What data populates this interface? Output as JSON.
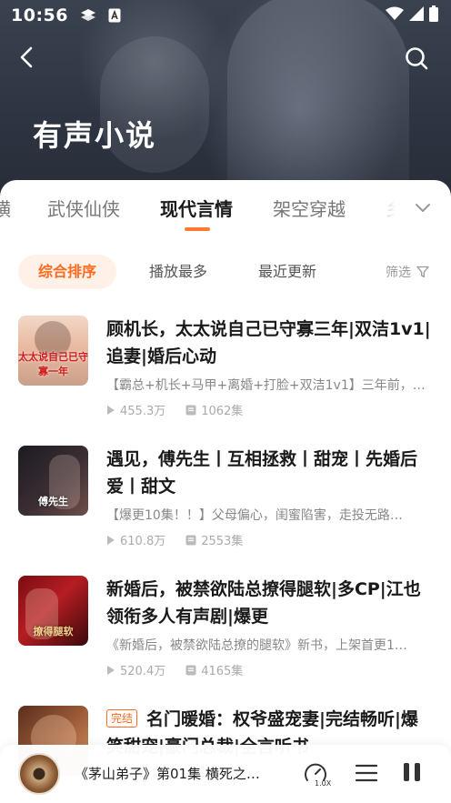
{
  "status_bar": {
    "time": "10:56"
  },
  "header": {
    "title": "有声小说"
  },
  "tabs": [
    {
      "label": "横",
      "active": false
    },
    {
      "label": "武侠仙侠",
      "active": false
    },
    {
      "label": "现代言情",
      "active": true
    },
    {
      "label": "架空穿越",
      "active": false
    },
    {
      "label": "乡",
      "active": false
    }
  ],
  "sort": {
    "options": [
      {
        "label": "综合排序",
        "active": true
      },
      {
        "label": "播放最多",
        "active": false
      },
      {
        "label": "最近更新",
        "active": false
      }
    ],
    "filter_label": "筛选"
  },
  "books": [
    {
      "cover_text": "太太说自己已守寡一年",
      "title": "顾机长，太太说自己已守寡三年|双洁1v1|追妻|婚后心动",
      "badge": "",
      "description": "【霸总+机长+马甲+离婚+打脸+双洁1v1】三年前，…",
      "plays": "455.3万",
      "episodes": "1062集"
    },
    {
      "cover_text": "傅先生",
      "title": "遇见，傅先生丨互相拯救丨甜宠丨先婚后爱丨甜文",
      "badge": "",
      "description": "【爆更10集！！】父母偏心，闺蜜陷害，走投无路…",
      "plays": "610.8万",
      "episodes": "2553集"
    },
    {
      "cover_text": "撩得腿软",
      "title": "新婚后，被禁欲陆总撩得腿软|多CP|江也领衔多人有声剧|爆更",
      "badge": "",
      "description": "《新婚后，被禁欲陆总撩的腿软》新书，上架首更1…",
      "plays": "520.4万",
      "episodes": "4165集"
    },
    {
      "cover_text": "",
      "title": "名门暖婚：权爷盛宠妻|完结畅听|爆笑甜宠|豪门总裁|全言听书",
      "badge": "完结",
      "description": "",
      "plays": "",
      "episodes": ""
    }
  ],
  "player": {
    "now_playing": "《茅山弟子》第01集 横死之…",
    "speed_label": "1.0X"
  },
  "colors": {
    "accent": "#ff7a2f",
    "accent_bg": "#fff1e8",
    "hero_bg": "#2e3542"
  }
}
